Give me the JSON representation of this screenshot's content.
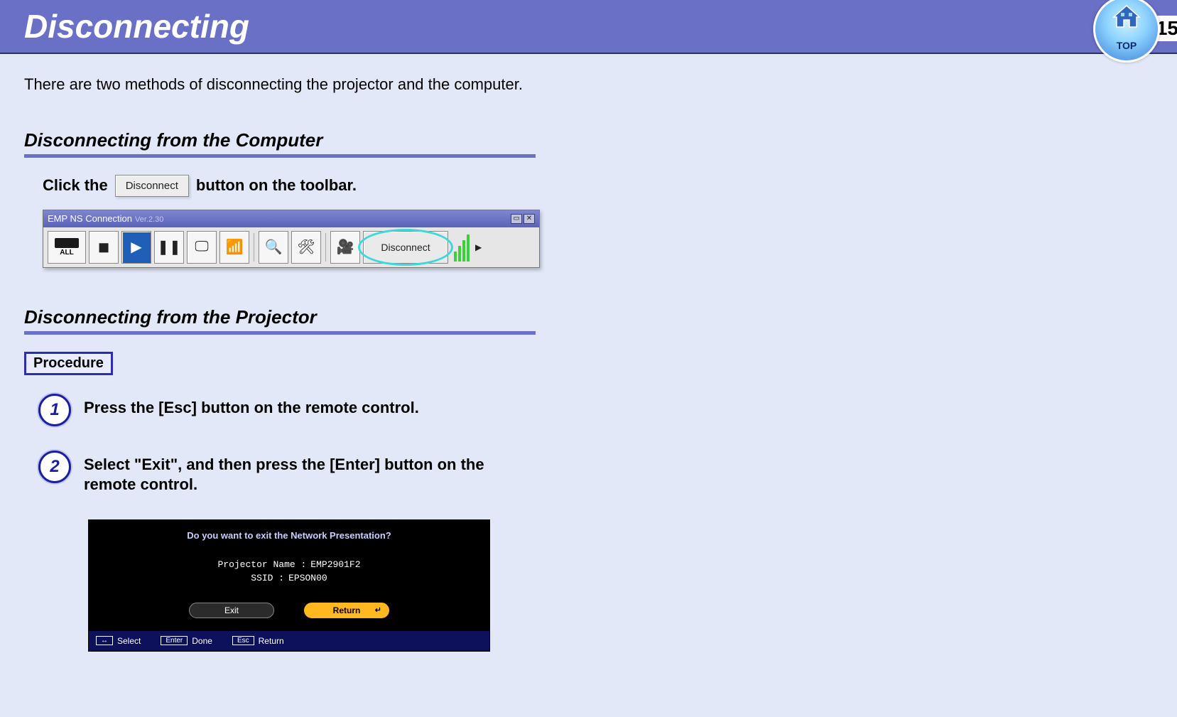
{
  "header": {
    "title": "Disconnecting",
    "top_label": "TOP",
    "page_number": "15"
  },
  "intro": "There are two methods of disconnecting the projector and the computer.",
  "section1": {
    "heading": "Disconnecting from the Computer",
    "click_pre": "Click the",
    "disconnect_btn": "Disconnect",
    "click_post": "button on the toolbar."
  },
  "toolbar": {
    "title": "EMP NS Connection",
    "version": "Ver.2.30",
    "all_label": "ALL",
    "disconnect_label": "Disconnect"
  },
  "section2": {
    "heading": "Disconnecting from the Projector",
    "procedure_label": "Procedure",
    "steps": [
      {
        "n": "1",
        "text": "Press the [Esc] button on the remote control."
      },
      {
        "n": "2",
        "text": "Select \"Exit\", and then press the [Enter] button on the remote control."
      }
    ]
  },
  "osd": {
    "question": "Do you want to exit the Network Presentation?",
    "proj_name_label": "Projector Name :",
    "proj_name_value": "EMP2901F2",
    "ssid_label": "SSID :",
    "ssid_value": "EPSON00",
    "exit_btn": "Exit",
    "return_btn": "Return",
    "footer_select_key": "↔",
    "footer_select": "Select",
    "footer_done_key": "Enter",
    "footer_done": "Done",
    "footer_return_key": "Esc",
    "footer_return": "Return"
  }
}
